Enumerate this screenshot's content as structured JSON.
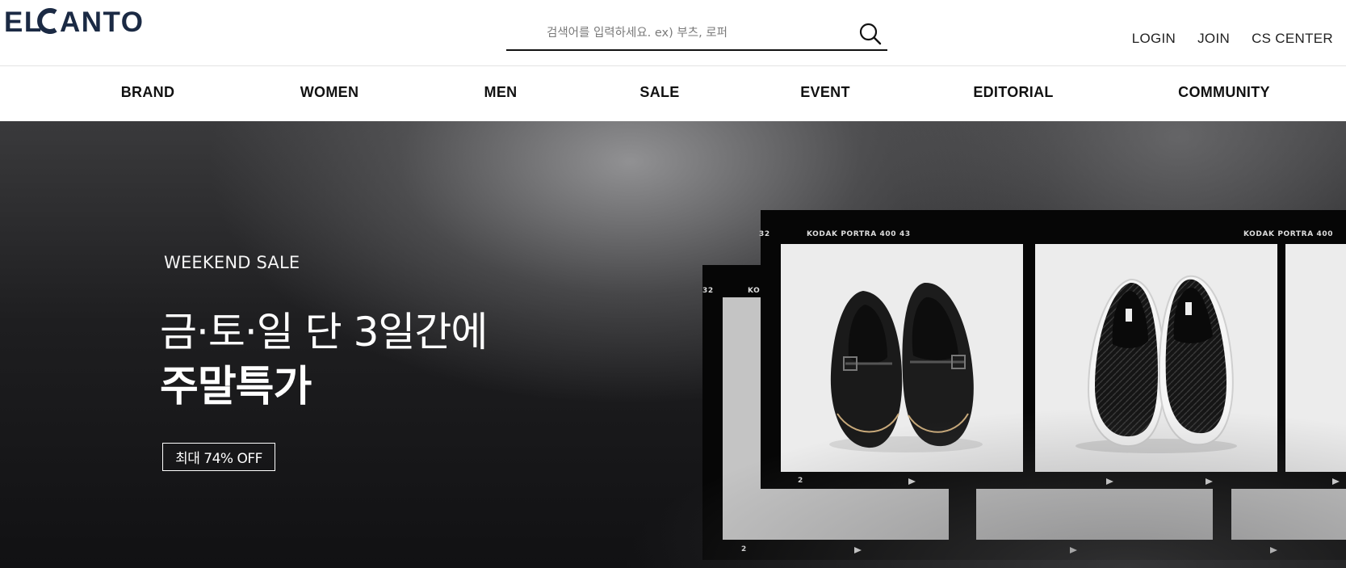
{
  "header": {
    "logo": "ELCANTO",
    "search": {
      "placeholder": "검색어를 입력하세요. ex) 부츠, 로퍼",
      "icon": "search-icon"
    },
    "util_links": [
      "LOGIN",
      "JOIN",
      "CS CENTER"
    ]
  },
  "nav": {
    "items": [
      "BRAND",
      "WOMEN",
      "MEN",
      "SALE",
      "EVENT",
      "EDITORIAL",
      "COMMUNITY"
    ]
  },
  "hero": {
    "kicker": "WEEKEND SALE",
    "headline_line1": "금·토·일 단 3일간에",
    "headline_line2": "주말특가",
    "badge": "최대 74% OFF",
    "film": {
      "front_label_left": "KODAK  PORTRA 400",
      "front_number_left": "43",
      "front_edge_number": "32",
      "front_label_right": "KODAK  PORTRA 400",
      "front_frame_number": "2",
      "back_edge_number": "32",
      "back_label": "KO",
      "back_frame_number": "2"
    },
    "products": [
      "loafer-shoes-image",
      "woven-slip-on-shoes-image"
    ]
  },
  "colors": {
    "logo": "#1b2a44",
    "text": "#111111",
    "hero_dark": "#111113"
  }
}
